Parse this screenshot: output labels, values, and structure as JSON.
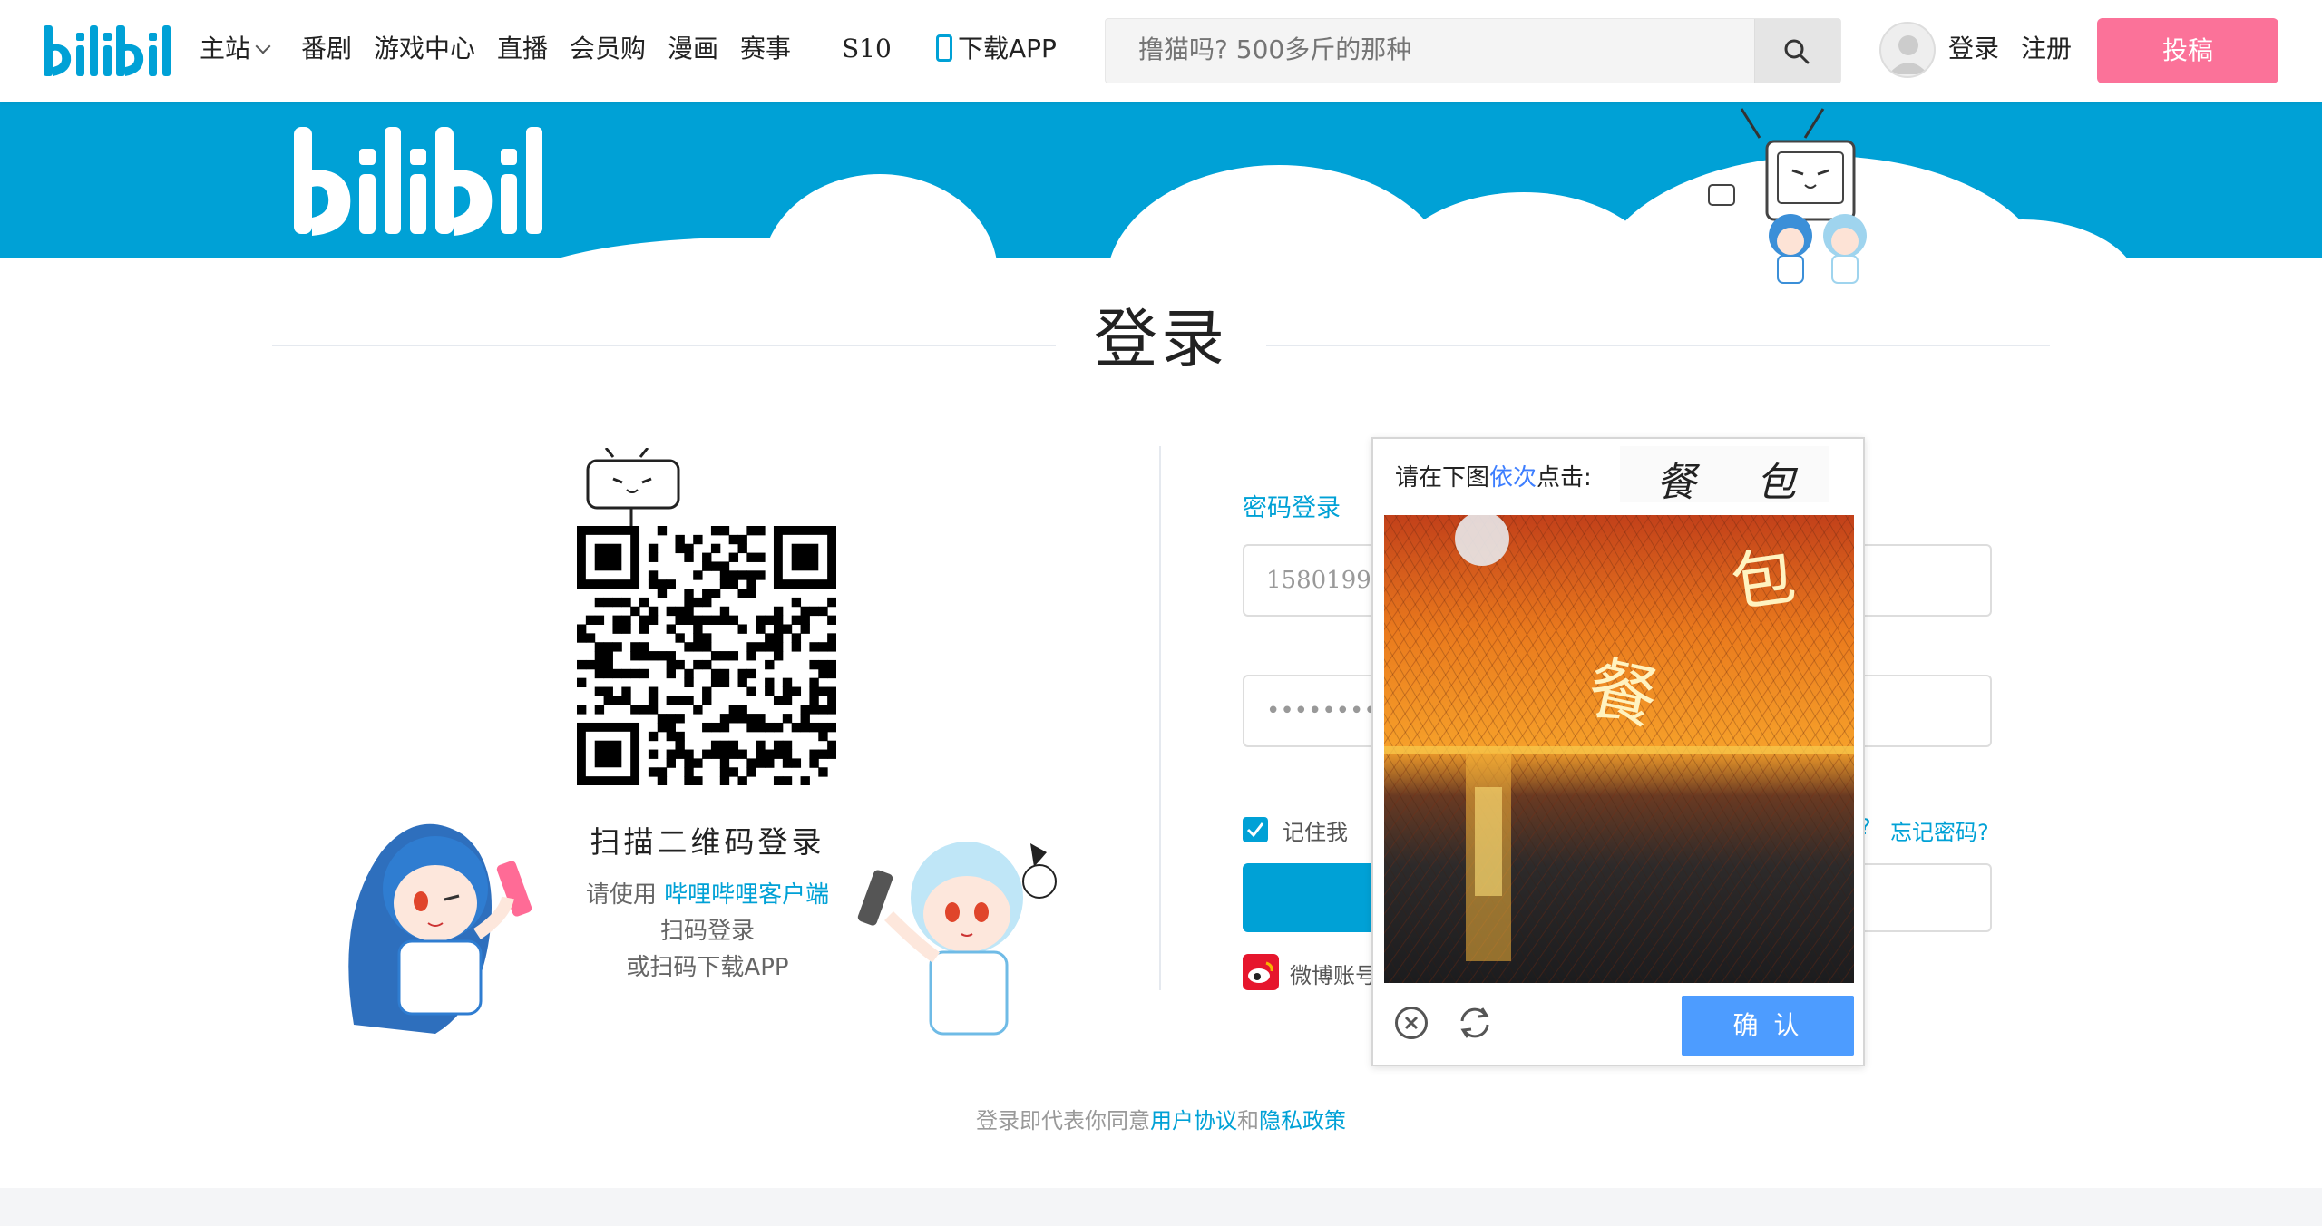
{
  "nav": {
    "items": [
      {
        "label": "主站"
      },
      {
        "label": "番剧"
      },
      {
        "label": "游戏中心"
      },
      {
        "label": "直播"
      },
      {
        "label": "会员购"
      },
      {
        "label": "漫画"
      },
      {
        "label": "赛事"
      },
      {
        "label": "S10"
      }
    ],
    "download_label": "下载APP",
    "search_placeholder": "撸猫吗? 500多斤的那种",
    "login_label": "登录",
    "register_label": "注册",
    "upload_label": "投稿"
  },
  "colors": {
    "brand": "#00a1d6",
    "accent_pink": "#fb7299",
    "captcha_button": "#4d9cff"
  },
  "page": {
    "title": "登录"
  },
  "qr": {
    "title": "扫描二维码登录",
    "line1_prefix": "请使用",
    "line1_link": "哔哩哔哩客户端",
    "line2": "扫码登录",
    "line3": "或扫码下载APP"
  },
  "login_form": {
    "tab_label": "密码登录",
    "username_value": "1580199997",
    "password_value": "•••••••••••••",
    "remember_label": "记住我",
    "remember_checked": true,
    "question_mark": "?",
    "forgot_label": "忘记密码?",
    "weibo_label": "微博账号"
  },
  "agreement": {
    "prefix": "登录即代表你同意",
    "link1": "用户协议",
    "and": "和",
    "link2": "隐私政策"
  },
  "captcha": {
    "prompt_prefix": "请在下图",
    "prompt_highlight": "依次",
    "prompt_suffix": "点击:",
    "chars": [
      "餐",
      "包"
    ],
    "image_chars": [
      "包",
      "餐"
    ],
    "confirm_label": "确 认",
    "icons": [
      "close-icon",
      "refresh-icon"
    ]
  }
}
